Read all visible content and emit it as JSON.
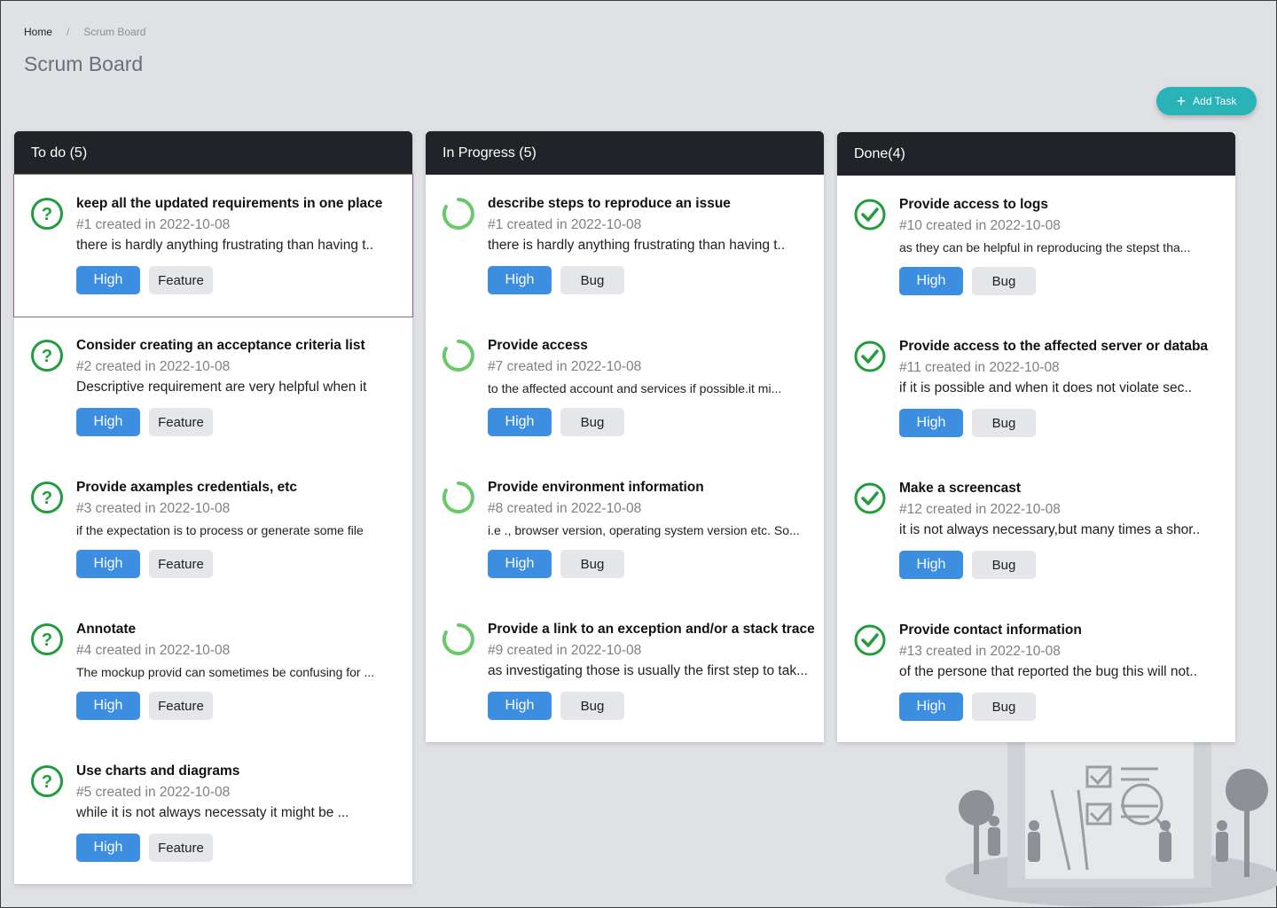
{
  "breadcrumb": {
    "home": "Home",
    "separator": "/",
    "current": "Scrum Board"
  },
  "page_title": "Scrum Board",
  "add_task": {
    "icon": "plus-icon",
    "label": "Add Task"
  },
  "colors": {
    "accent": "#2ab3b6",
    "priority": "#3b8ee0",
    "header": "#202327",
    "done": "#1f9d3a",
    "progress": "#6cc66c"
  },
  "columns": [
    {
      "header": "To do (5)",
      "cards": [
        {
          "title": "keep all the updated requirements in one place",
          "meta": "#1 created in 2022-10-08",
          "desc": "there is hardly anything frustrating than having t..",
          "priority": "High",
          "type": "Feature"
        },
        {
          "title": "Consider creating an acceptance criteria list",
          "meta": "#2 created in 2022-10-08",
          "desc": "Descriptive requirement are very helpful when it",
          "priority": "High",
          "type": "Feature"
        },
        {
          "title": "Provide axamples credentials, etc",
          "meta": "#3 created in 2022-10-08",
          "desc": "if the expectation is to process or generate some file",
          "priority": "High",
          "type": "Feature"
        },
        {
          "title": "Annotate",
          "meta": "#4 created in 2022-10-08",
          "desc": "The mockup provid can sometimes be confusing for ...",
          "priority": "High",
          "type": "Feature"
        },
        {
          "title": "Use charts and diagrams",
          "meta": "#5 created in 2022-10-08",
          "desc": "while it is not always necessaty it might be ...",
          "priority": "High",
          "type": "Feature"
        }
      ]
    },
    {
      "header": "In Progress (5)",
      "cards": [
        {
          "title": "describe steps to reproduce an issue",
          "meta": "#1 created in 2022-10-08",
          "desc": "there is hardly anything frustrating than having t..",
          "priority": "High",
          "type": "Bug"
        },
        {
          "title": "Provide access",
          "meta": "#7 created in 2022-10-08",
          "desc": "to the affected account and services if possible.it mi...",
          "priority": "High",
          "type": "Bug"
        },
        {
          "title": "Provide environment information",
          "meta": "#8 created in 2022-10-08",
          "desc": "i.e ., browser version, operating system version etc. So...",
          "priority": "High",
          "type": "Bug"
        },
        {
          "title": "Provide a link to an exception and/or a stack trace",
          "meta": "#9 created in 2022-10-08",
          "desc": "as investigating those is usually the first step to tak...",
          "priority": "High",
          "type": "Bug"
        }
      ]
    },
    {
      "header": "Done(4)",
      "cards": [
        {
          "title": "Provide access to logs",
          "meta": "#10 created in 2022-10-08",
          "desc": "as they can be helpful in reproducing the stepst tha...",
          "priority": "High",
          "type": "Bug"
        },
        {
          "title": "Provide access to the affected server or databa",
          "meta": "#11 created in 2022-10-08",
          "desc": "if it is  possible and when it does not violate sec..",
          "priority": "High",
          "type": "Bug"
        },
        {
          "title": "Make a screencast",
          "meta": "#12 created in 2022-10-08",
          "desc": "it is not always necessary,but many times a shor..",
          "priority": "High",
          "type": "Bug"
        },
        {
          "title": "Provide contact information",
          "meta": "#13 created in 2022-10-08",
          "desc": "of the persone that reported the bug this will not..",
          "priority": "High",
          "type": "Bug"
        }
      ]
    }
  ]
}
